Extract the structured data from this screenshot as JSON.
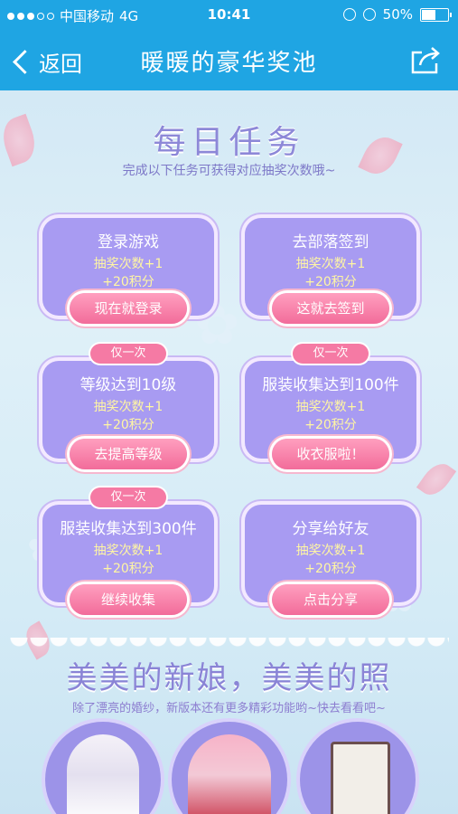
{
  "status_bar": {
    "carrier": "中国移动",
    "network": "4G",
    "time": "10:41",
    "battery": "50%",
    "battery_level": 0.5
  },
  "nav": {
    "back_label": "返回",
    "title": "暖暖的豪华奖池"
  },
  "tasks_section": {
    "heading": "每日任务",
    "subheading": "完成以下任务可获得对应抽奖次数哦~",
    "tasks": [
      {
        "title": "登录游戏",
        "reward_draws": "抽奖次数+1",
        "reward_points": "+20积分",
        "button": "现在就登录",
        "badge": ""
      },
      {
        "title": "去部落签到",
        "reward_draws": "抽奖次数+1",
        "reward_points": "+20积分",
        "button": "这就去签到",
        "badge": ""
      },
      {
        "title": "等级达到10级",
        "reward_draws": "抽奖次数+1",
        "reward_points": "+20积分",
        "button": "去提高等级",
        "badge": "仅一次"
      },
      {
        "title": "服装收集达到100件",
        "reward_draws": "抽奖次数+1",
        "reward_points": "+20积分",
        "button": "收衣服啦！",
        "badge": "仅一次"
      },
      {
        "title": "服装收集达到300件",
        "reward_draws": "抽奖次数+1",
        "reward_points": "+20积分",
        "button": "继续收集",
        "badge": "仅一次"
      },
      {
        "title": "分享给好友",
        "reward_draws": "抽奖次数+1",
        "reward_points": "+20积分",
        "button": "点击分享",
        "badge": ""
      }
    ]
  },
  "promo_section": {
    "heading": "美美的新娘，美美的照",
    "subheading": "除了漂亮的婚纱，新版本还有更多精彩功能哟~快去看看吧~",
    "items": [
      {
        "icon": "bride-avatar-icon"
      },
      {
        "icon": "twins-avatar-icon"
      },
      {
        "icon": "book-clock-icon"
      }
    ]
  },
  "colors": {
    "nav_bg": "#1fa5e3",
    "card_bg": "#a89bf2",
    "button_pink": "#f26c9a",
    "reward_text": "#fff6a3",
    "heading": "#8d88d8"
  }
}
